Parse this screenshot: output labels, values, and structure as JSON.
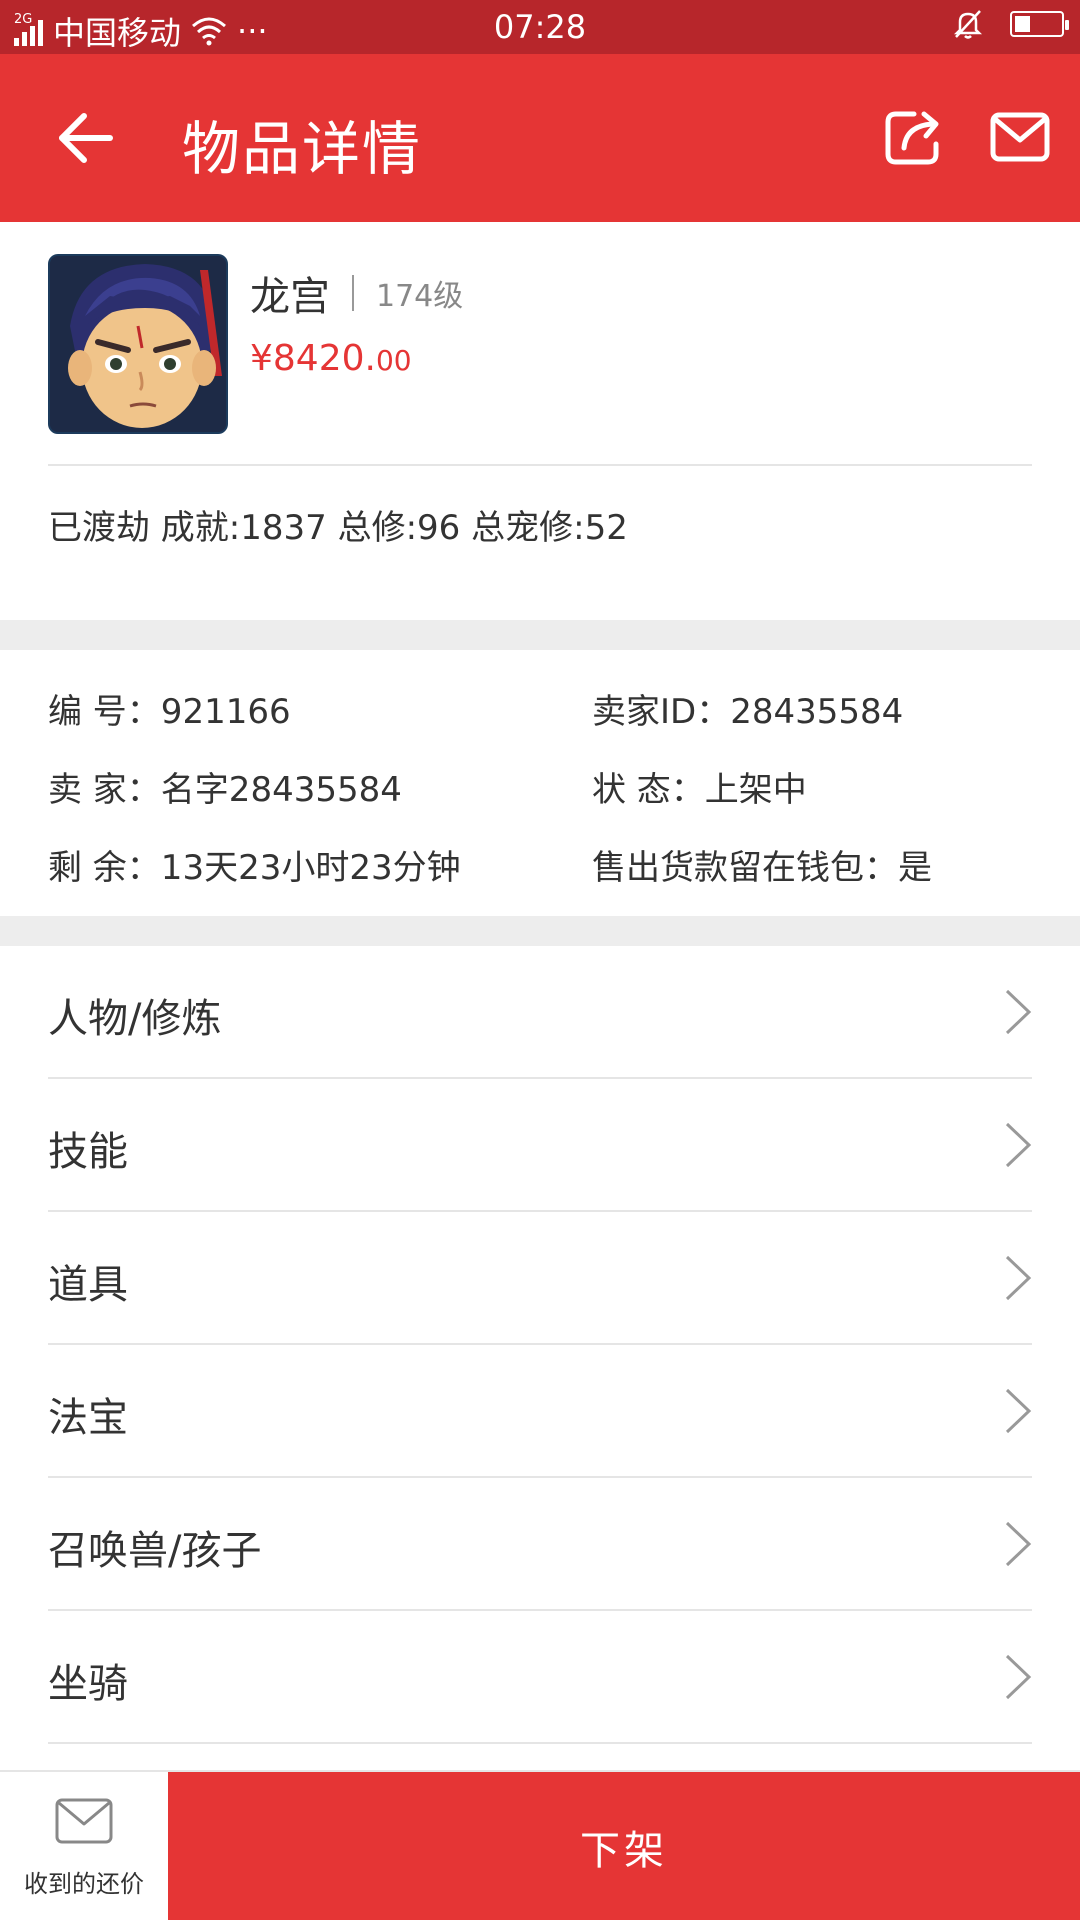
{
  "status_bar": {
    "network": "2G",
    "carrier": "中国移动",
    "more": "···",
    "time": "07:28",
    "battery_level": 0.3
  },
  "header": {
    "title": "物品详情"
  },
  "item": {
    "name": "龙宫",
    "level": "174级",
    "price_main": "¥8420.",
    "price_decimal": "00",
    "summary": "已渡劫 成就:1837 总修:96 总宠修:52"
  },
  "info": {
    "number": "编  号：921166",
    "seller_id": "卖家ID：28435584",
    "seller": "卖  家：名字28435584",
    "status": "状  态：上架中",
    "remaining": "剩  余：13天23小时23分钟",
    "wallet": "售出货款留在钱包：是"
  },
  "menu": {
    "items": [
      {
        "label": "人物/修炼"
      },
      {
        "label": "技能"
      },
      {
        "label": "道具"
      },
      {
        "label": "法宝"
      },
      {
        "label": "召唤兽/孩子"
      },
      {
        "label": "坐骑"
      }
    ]
  },
  "bottom": {
    "offers_label": "收到的还价",
    "delist_label": "下架"
  },
  "colors": {
    "primary": "#e53535",
    "status_bar": "#b7262b"
  }
}
